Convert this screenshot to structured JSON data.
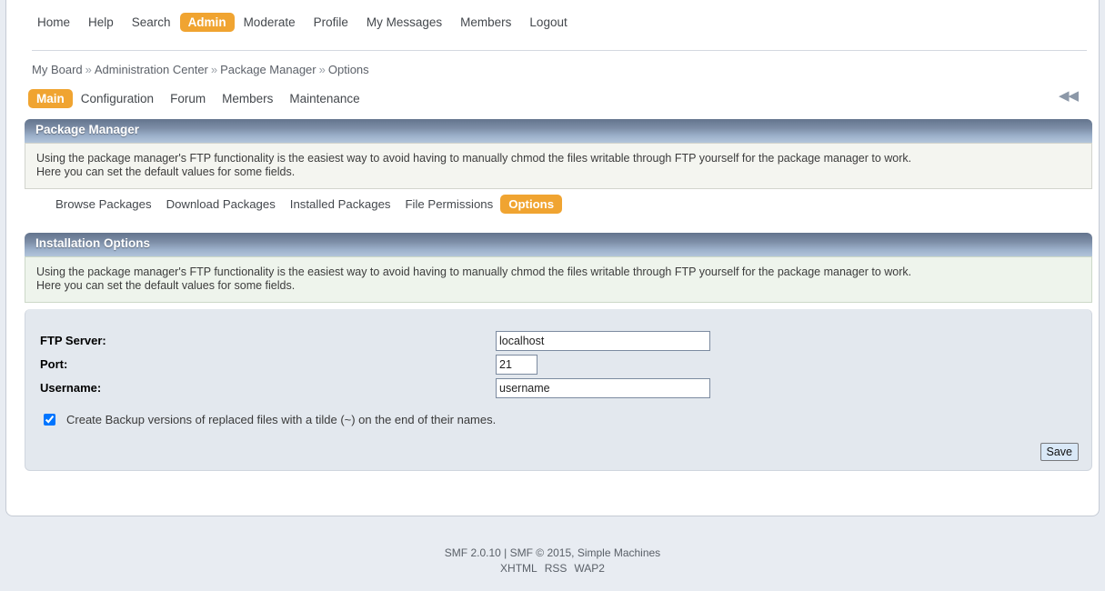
{
  "topnav": {
    "items": [
      {
        "label": "Home",
        "active": false
      },
      {
        "label": "Help",
        "active": false
      },
      {
        "label": "Search",
        "active": false
      },
      {
        "label": "Admin",
        "active": true
      },
      {
        "label": "Moderate",
        "active": false
      },
      {
        "label": "Profile",
        "active": false
      },
      {
        "label": "My Messages",
        "active": false
      },
      {
        "label": "Members",
        "active": false
      },
      {
        "label": "Logout",
        "active": false
      }
    ]
  },
  "breadcrumb": {
    "items": [
      "My Board",
      "Administration Center",
      "Package Manager",
      "Options"
    ],
    "separator": "»"
  },
  "admin_tabs": {
    "items": [
      {
        "label": "Main",
        "active": true
      },
      {
        "label": "Configuration",
        "active": false
      },
      {
        "label": "Forum",
        "active": false
      },
      {
        "label": "Members",
        "active": false
      },
      {
        "label": "Maintenance",
        "active": false
      }
    ],
    "collapse_icon": "double-chevron-left",
    "collapse_glyph": "◀◀"
  },
  "package_manager": {
    "title": "Package Manager",
    "description_line1": "Using the package manager's FTP functionality is the easiest way to avoid having to manually chmod the files writable through FTP yourself for the package manager to work.",
    "description_line2": "Here you can set the default values for some fields."
  },
  "subnav": {
    "items": [
      {
        "label": "Browse Packages",
        "active": false
      },
      {
        "label": "Download Packages",
        "active": false
      },
      {
        "label": "Installed Packages",
        "active": false
      },
      {
        "label": "File Permissions",
        "active": false
      },
      {
        "label": "Options",
        "active": true
      }
    ]
  },
  "installation_options": {
    "title": "Installation Options",
    "description_line1": "Using the package manager's FTP functionality is the easiest way to avoid having to manually chmod the files writable through FTP yourself for the package manager to work.",
    "description_line2": "Here you can set the default values for some fields.",
    "fields": [
      {
        "label": "FTP Server:",
        "value": "localhost",
        "name": "ftp-server"
      },
      {
        "label": "Port:",
        "value": "21",
        "name": "ftp-port"
      },
      {
        "label": "Username:",
        "value": "username",
        "name": "ftp-username"
      }
    ],
    "backup_checkbox": {
      "label": "Create Backup versions of replaced files with a tilde (~) on the end of their names.",
      "checked": true
    },
    "save_label": "Save"
  },
  "footer": {
    "copyright": "SMF 2.0.10 | SMF © 2015, Simple Machines",
    "links": [
      "XHTML",
      "RSS",
      "WAP2"
    ]
  },
  "colors": {
    "accent_orange": "#f0a431",
    "title_bar_dark": "#63748d",
    "title_bar_light": "#b3c5da",
    "panel_bg": "#e3e8ee",
    "page_bg": "#e8ecf2"
  }
}
